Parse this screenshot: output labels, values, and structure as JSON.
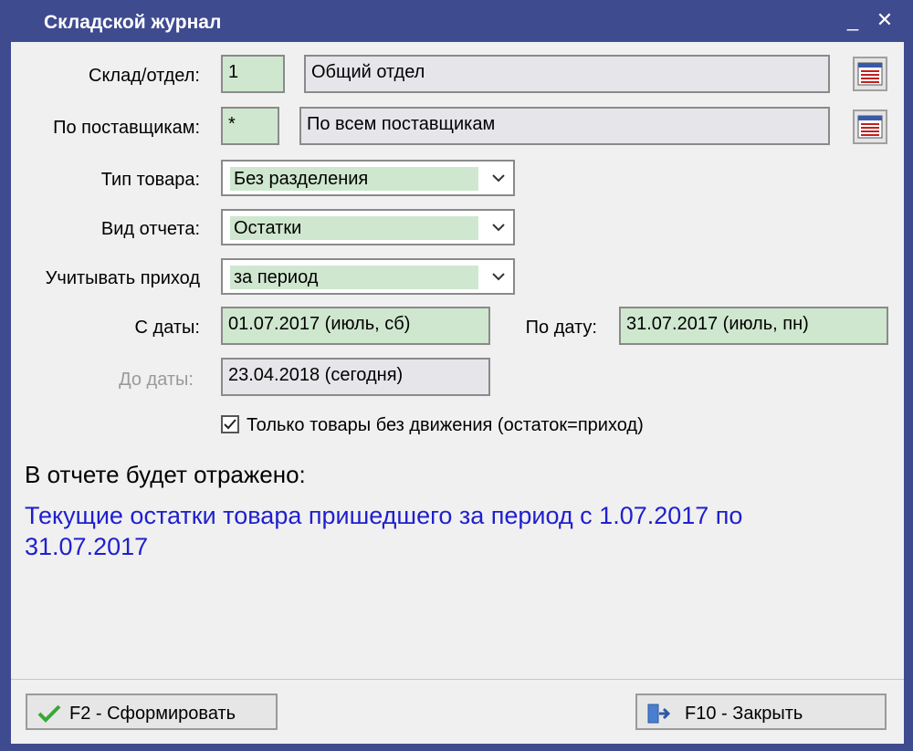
{
  "window": {
    "title": "Складской журнал",
    "minimize_glyph": "_",
    "close_glyph": "✕"
  },
  "warehouse": {
    "label": "Склад/отдел:",
    "code": "1",
    "name": "Общий отдел",
    "picker_icon": "list-icon"
  },
  "suppliers": {
    "label": "По поставщикам:",
    "code": "*",
    "name": "По всем поставщикам",
    "picker_icon": "list-icon"
  },
  "goods_type": {
    "label": "Тип товара:",
    "value": "Без разделения"
  },
  "report_type": {
    "label": "Вид отчета:",
    "value": "Остатки"
  },
  "income": {
    "label": "Учитывать приход",
    "value": "за период"
  },
  "date_from": {
    "label": "С даты:",
    "value": "01.07.2017  (июль, сб)"
  },
  "date_to": {
    "label": "По дату:",
    "value": "31.07.2017  (июль, пн)"
  },
  "date_until": {
    "label": "До даты:",
    "value": "23.04.2018  (сегодня)"
  },
  "only_no_movement": {
    "label": "Только товары без движения (остаток=приход)",
    "checked": true
  },
  "report": {
    "heading": "В отчете будет отражено:",
    "summary": "Текущие остатки товара пришедшего за период с 1.07.2017 по 31.07.2017",
    "summary_color": "#1f1fcf"
  },
  "footer": {
    "generate_label": "F2 - Сформировать",
    "generate_icon": "checkmark-icon",
    "close_label": "F10 - Закрыть",
    "close_icon": "exit-door-icon"
  },
  "colors": {
    "titlebar": "#3f4b8f",
    "input_green": "#cfe7cf",
    "input_gray": "#e6e6ea"
  }
}
